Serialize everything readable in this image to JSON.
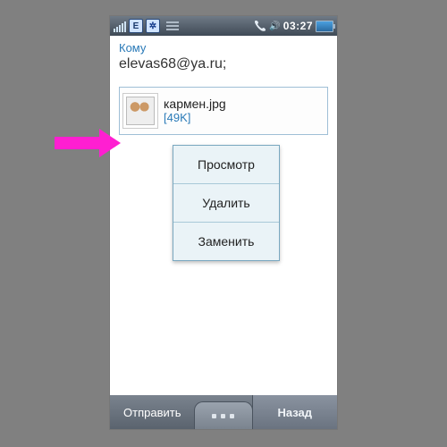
{
  "status": {
    "net_label": "E",
    "bt_label": "✲",
    "speaker_label": "🔊",
    "time": "03:27"
  },
  "compose": {
    "to_label": "Кому",
    "recipient": "elevas68@ya.ru;"
  },
  "attachment": {
    "filename": "кармен.jpg",
    "size": "[49K]"
  },
  "menu": {
    "view": "Просмотр",
    "delete": "Удалить",
    "replace": "Заменить"
  },
  "softkeys": {
    "left": "Отправить",
    "right": "Назад"
  }
}
